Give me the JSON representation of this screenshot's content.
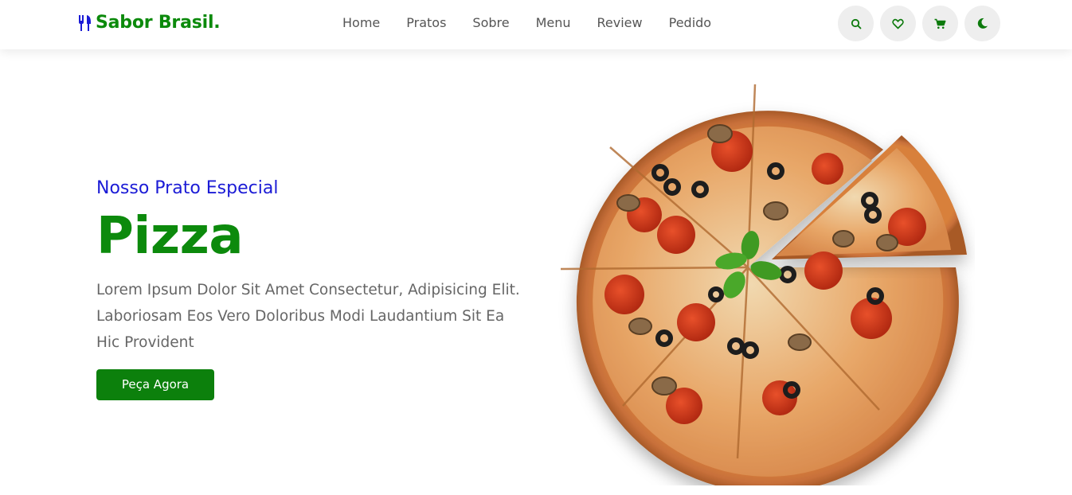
{
  "header": {
    "logo_text": "Sabor Brasil.",
    "logo_icon": "utensils-icon",
    "nav": [
      {
        "label": "Home"
      },
      {
        "label": "Pratos"
      },
      {
        "label": "Sobre"
      },
      {
        "label": "Menu"
      },
      {
        "label": "Review"
      },
      {
        "label": "Pedido"
      }
    ],
    "icons": [
      "search-icon",
      "heart-icon",
      "cart-icon",
      "moon-icon"
    ]
  },
  "hero": {
    "subtitle": "Nosso Prato Especial",
    "title": "Pizza",
    "description": "Lorem Ipsum Dolor Sit Amet Consectetur, Adipisicing Elit. Laboriosam Eos Vero Doloribus Modi Laudantium Sit Ea Hic Provident",
    "button_label": "Peça Agora",
    "image": "pizza-image"
  },
  "colors": {
    "brand_green": "#0c8a0c",
    "subtitle_blue": "#1b1bd6",
    "text_gray": "#666666",
    "icon_bg": "#eeeeee"
  }
}
